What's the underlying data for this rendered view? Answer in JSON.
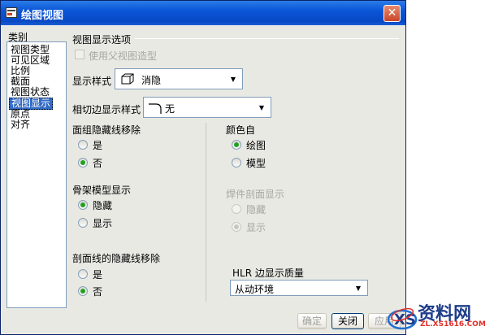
{
  "window": {
    "title": "绘图视图",
    "close_symbol": "✕"
  },
  "category": {
    "header": "类别",
    "items": [
      "视图类型",
      "可见区域",
      "比例",
      "截面",
      "视图状态",
      "视图显示",
      "原点",
      "对齐"
    ],
    "selected_index": 5
  },
  "options": {
    "group_title": "视图显示选项",
    "use_parent": {
      "label": "使用父视图造型",
      "checked": false,
      "enabled": false
    },
    "display_style": {
      "label": "显示样式",
      "value": "消隐"
    },
    "tangent_style": {
      "label": "相切边显示样式",
      "value": "无"
    },
    "face_hidden_removal": {
      "title": "面组隐藏线移除",
      "options": [
        "是",
        "否"
      ],
      "selected": "否"
    },
    "color_from": {
      "title": "颜色自",
      "options": [
        "绘图",
        "模型"
      ],
      "selected": "绘图"
    },
    "skeleton": {
      "title": "骨架模型显示",
      "options": [
        "隐藏",
        "显示"
      ],
      "selected": "隐藏"
    },
    "weld_section": {
      "title": "焊件剖面显示",
      "options": [
        "隐藏",
        "显示"
      ],
      "selected": "显示",
      "enabled": false
    },
    "xsec_hidden_removal": {
      "title": "剖面线的隐藏线移除",
      "options": [
        "是",
        "否"
      ],
      "selected": "否"
    },
    "hlr_quality": {
      "label": "HLR 边显示质量",
      "value": "从动环境"
    }
  },
  "buttons": {
    "ok": "确定",
    "close": "关闭",
    "apply": "应用"
  },
  "watermark": {
    "text": "资料网",
    "url": "ZL.XS1616.COM"
  },
  "colors": {
    "title_bar": "#0a56d8",
    "selection": "#316ac5",
    "radio_on": "#21a121"
  }
}
